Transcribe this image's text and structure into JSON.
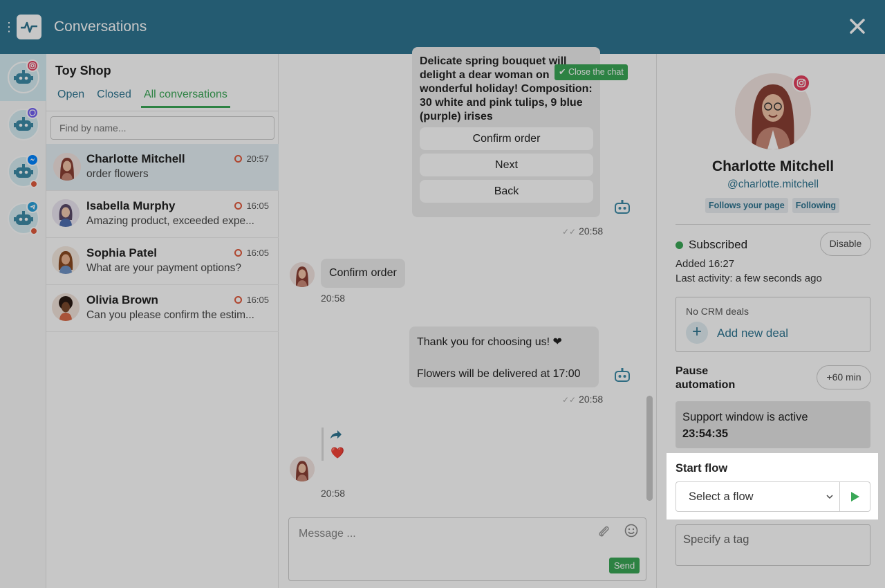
{
  "app": {
    "title": "Conversations"
  },
  "channels": [
    {
      "name": "instagram",
      "badge_color": "#e4405f",
      "active": true,
      "unread": false
    },
    {
      "name": "viber",
      "badge_color": "#7360f2",
      "active": false,
      "unread": false
    },
    {
      "name": "messenger",
      "badge_color": "#0084ff",
      "active": false,
      "unread": true
    },
    {
      "name": "telegram",
      "badge_color": "#2aa1da",
      "active": false,
      "unread": true
    }
  ],
  "list": {
    "shop_name": "Toy Shop",
    "tabs": [
      "Open",
      "Closed",
      "All conversations"
    ],
    "active_tab": "All conversations",
    "search_placeholder": "Find by name...",
    "conversations": [
      {
        "name": "Charlotte Mitchell",
        "preview": "order flowers",
        "time": "20:57",
        "selected": true
      },
      {
        "name": "Isabella Murphy",
        "preview": "Amazing product, exceeded expe...",
        "time": "16:05",
        "selected": false
      },
      {
        "name": "Sophia Patel",
        "preview": "What are your payment options?",
        "time": "16:05",
        "selected": false
      },
      {
        "name": "Olivia Brown",
        "preview": "Can you please confirm the estim...",
        "time": "16:05",
        "selected": false
      }
    ]
  },
  "chat": {
    "close_chat_label": "Close the chat",
    "bot_message": "Delicate spring bouquet will delight a dear woman on wonderful holiday! Composition: 30 white and pink tulips, 9 blue (purple) irises",
    "quick_replies": [
      "Confirm order",
      "Next",
      "Back"
    ],
    "bot_time_1": "20:58",
    "user_message_1": "Confirm order",
    "user_time_1": "20:58",
    "bot_reply_line1": "Thank you for choosing us! ❤",
    "bot_reply_line2": "Flowers will be delivered at 17:00",
    "bot_time_2": "20:58",
    "forwarded_emoji": "❤️",
    "user_time_2": "20:58",
    "composer_placeholder": "Message ...",
    "send_label": "Send"
  },
  "contact": {
    "name": "Charlotte Mitchell",
    "handle": "@charlotte.mitchell",
    "tags": [
      "Follows your page",
      "Following"
    ],
    "status": "Subscribed",
    "disable_label": "Disable",
    "added": "Added 16:27",
    "last_activity": "Last activity: a few seconds ago",
    "crm_label": "No CRM deals",
    "add_deal_label": "Add new deal",
    "pause_line1": "Pause",
    "pause_line2": "automation",
    "pause_button": "+60 min",
    "support_window_text": "Support window is active",
    "support_window_timer": "23:54:35",
    "start_flow_label": "Start flow",
    "flow_select_value": "Select a flow",
    "tag_placeholder": "Specify a tag"
  },
  "colors": {
    "header": "#2f7591",
    "accent_green": "#3aa757",
    "status_red": "#e05a3d",
    "instagram": "#e4405f"
  }
}
